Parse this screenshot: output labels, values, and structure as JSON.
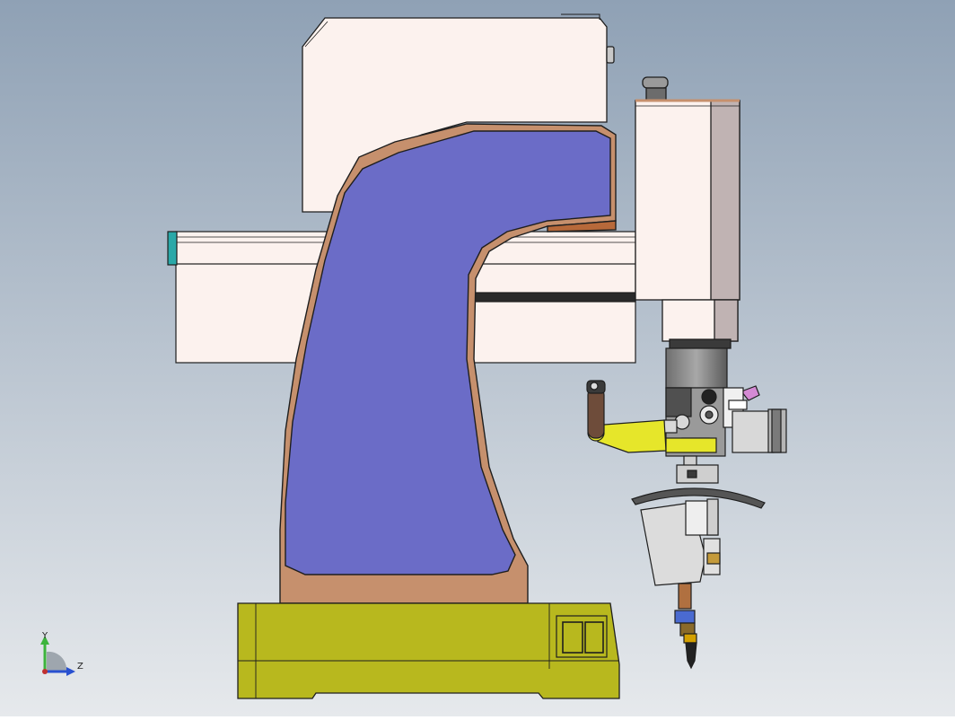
{
  "colors": {
    "bg_top": "#8fa1b5",
    "bg_bottom": "#e6e9ec",
    "housing": "#fcf2ee",
    "housing_shade": "#c0b3b3",
    "column_face": "#6b6cc7",
    "column_rim": "#c6906d",
    "base": "#b8b81e",
    "bracket": "#e6e62a",
    "outline": "#1e1e1e",
    "axis_y": "#3cb43c",
    "axis_z": "#2850d0"
  },
  "triad": {
    "y_label": "Y",
    "z_label": "Z"
  }
}
